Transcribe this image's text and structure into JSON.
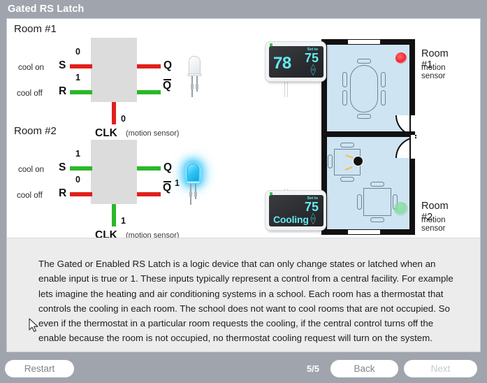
{
  "window": {
    "title": "Gated RS Latch"
  },
  "rooms": [
    {
      "id": "room1",
      "name": "Room #1",
      "set_label": "cool on",
      "reset_label": "cool off",
      "s_pin": "S",
      "r_pin": "R",
      "q_pin": "Q",
      "qbar_pin": "Q",
      "s_value": "0",
      "r_value": "1",
      "clk_value": "0",
      "clk_label": "CLK",
      "clk_note": "(motion sensor)",
      "s_color": "#e0201b",
      "r_color": "#2ab82a",
      "q_color": "#e0201b",
      "qbar_color": "#2ab82a",
      "clk_color": "#e0201b",
      "led_state": "off",
      "led_value": "",
      "thermostat": {
        "temp": "78",
        "mode": "",
        "set_label": "Set to",
        "set_point": "75"
      },
      "motion_sensor_state": "no-motion",
      "motion_sensor_color": "#f5252f",
      "floor_label": "Room #1",
      "floor_sub": "motion sensor"
    },
    {
      "id": "room2",
      "name": "Room #2",
      "set_label": "cool on",
      "reset_label": "cool off",
      "s_pin": "S",
      "r_pin": "R",
      "q_pin": "Q",
      "qbar_pin": "Q",
      "s_value": "1",
      "r_value": "0",
      "clk_value": "1",
      "clk_label": "CLK",
      "clk_note": "(motion sensor)",
      "s_color": "#2ab82a",
      "r_color": "#e0201b",
      "q_color": "#2ab82a",
      "qbar_color": "#e0201b",
      "clk_color": "#2ab82a",
      "led_state": "on",
      "led_value": "1",
      "thermostat": {
        "temp": "",
        "mode": "Cooling",
        "set_label": "Set to",
        "set_point": "75"
      },
      "motion_sensor_state": "motion",
      "motion_sensor_color": "#78d696",
      "floor_label": "Room #2",
      "floor_sub": "motion sensor"
    }
  ],
  "description": {
    "text": "The Gated or Enabled RS Latch is a logic device that can only change states or latched when an enable input is true or 1. These inputs typically represent a control from a central facility. For example lets imagine the heating and air conditioning systems in a school. Each room has a thermostat that controls the cooling in each room. The school does not want to cool rooms that are not occupied. So even if the thermostat in a particular room requests the cooling, if the central control turns off the enable because the room is not occupied, no thermostat cooling request will turn on the system."
  },
  "footer": {
    "restart_label": "Restart",
    "back_label": "Back",
    "next_label": "Next",
    "page_indicator": "5/5"
  },
  "colors": {
    "signal_high": "#2ab82a",
    "signal_low": "#e0201b",
    "chrome": "#a0a4ad",
    "panel": "#ececed",
    "thermostat_text": "#66e8ef",
    "room_fill": "#cfe4f2"
  }
}
